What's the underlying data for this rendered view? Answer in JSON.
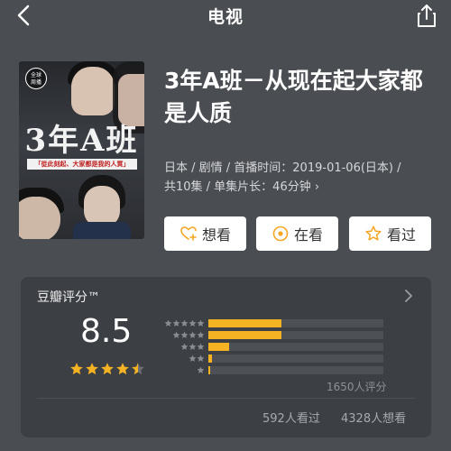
{
  "header": {
    "title": "电视",
    "back_icon": "chevron-left-icon",
    "share_icon": "share-icon"
  },
  "poster": {
    "badge": "全球\n周播",
    "big_text": "3年A班",
    "tagline": "「從此刻起、大家都是我的人質」"
  },
  "show": {
    "title": "3年A班－从现在起大家都是人质",
    "meta_line1": "日本 / 剧情 / 首播时间：2019-01-06(日本) /",
    "meta_line2": "共10集 / 单集片长：46分钟",
    "meta_more": "›"
  },
  "actions": [
    {
      "label": "想看",
      "icon": "heart-plus-icon",
      "color": "#f5a623"
    },
    {
      "label": "在看",
      "icon": "target-icon",
      "color": "#f5a623"
    },
    {
      "label": "看过",
      "icon": "star-outline-icon",
      "color": "#f5a623"
    }
  ],
  "rating": {
    "source": "豆瓣评分™",
    "score": "8.5",
    "stars": 4.5,
    "distribution": [
      {
        "stars": 5,
        "percent": 42
      },
      {
        "stars": 4,
        "percent": 42
      },
      {
        "stars": 3,
        "percent": 12
      },
      {
        "stars": 2,
        "percent": 2
      },
      {
        "stars": 1,
        "percent": 1
      }
    ],
    "count": "1650人评分",
    "watched": "592人看过",
    "want": "4328人想看"
  },
  "colors": {
    "accent": "#f5b324",
    "background": "#4a4d52",
    "card": "#3c3f44"
  }
}
